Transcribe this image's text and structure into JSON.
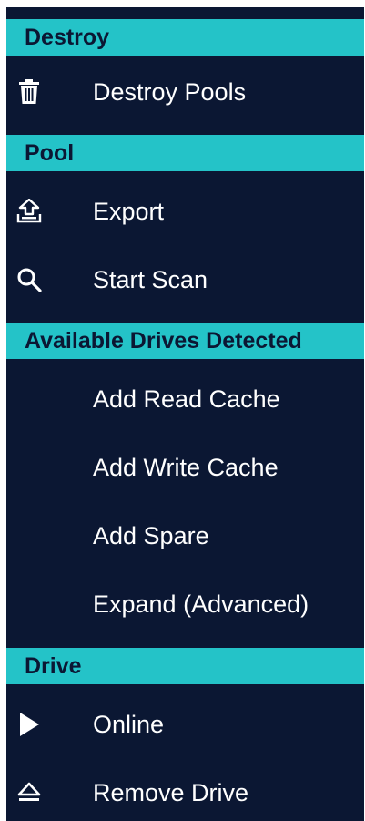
{
  "colors": {
    "background": "#0b1733",
    "header": "#24c3c8",
    "header_text": "#0b1733",
    "item_text": "#ffffff"
  },
  "sections": [
    {
      "title": "Destroy",
      "items": [
        {
          "label": "Destroy Pools",
          "icon": "trash-icon"
        }
      ]
    },
    {
      "title": "Pool",
      "items": [
        {
          "label": "Export",
          "icon": "export-icon"
        },
        {
          "label": "Start Scan",
          "icon": "search-icon"
        }
      ]
    },
    {
      "title": "Available Drives Detected",
      "items": [
        {
          "label": "Add Read Cache",
          "icon": ""
        },
        {
          "label": "Add Write Cache",
          "icon": ""
        },
        {
          "label": "Add Spare",
          "icon": ""
        },
        {
          "label": "Expand (Advanced)",
          "icon": ""
        }
      ]
    },
    {
      "title": "Drive",
      "items": [
        {
          "label": "Online",
          "icon": "play-icon"
        },
        {
          "label": "Remove Drive",
          "icon": "eject-icon"
        }
      ]
    }
  ]
}
